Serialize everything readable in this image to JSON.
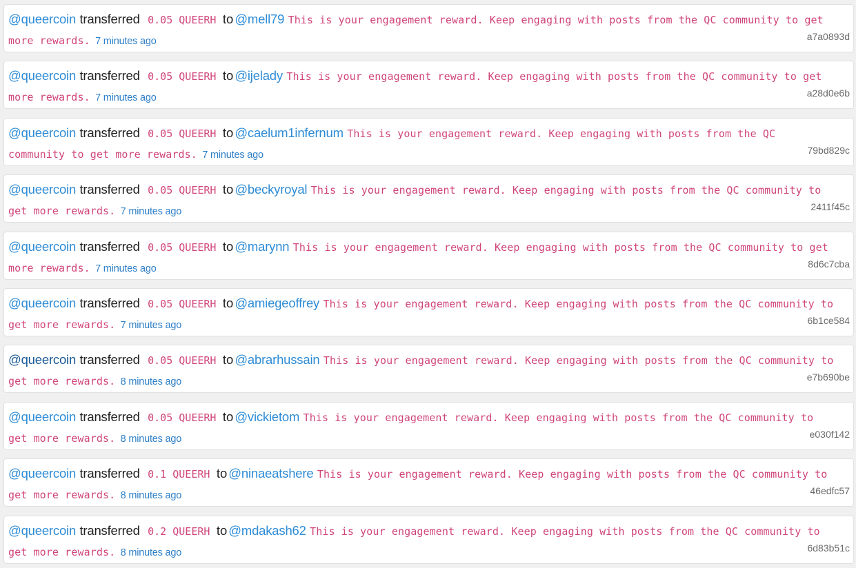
{
  "colors": {
    "page_background": "#f0f0f0",
    "card_background": "#ffffff",
    "link": "#2e8cd6",
    "link_hover": "#1a5a96",
    "memo_and_amount": "#d0457a",
    "timestamp": "#2e7fc7",
    "hash": "#6b6b6b"
  },
  "transfers": [
    {
      "from": "@queercoin",
      "verb": "transferred",
      "amount": "0.05 QUEERH",
      "to_word": "to",
      "to": "@mell79",
      "memo": "This is your engagement reward. Keep engaging with posts from the QC community to get more rewards.",
      "time": "7 minutes ago",
      "hash": "a7a0893d",
      "from_hover": false
    },
    {
      "from": "@queercoin",
      "verb": "transferred",
      "amount": "0.05 QUEERH",
      "to_word": "to",
      "to": "@ijelady",
      "memo": "This is your engagement reward. Keep engaging with posts from the QC community to get more rewards.",
      "time": "7 minutes ago",
      "hash": "a28d0e6b",
      "from_hover": false
    },
    {
      "from": "@queercoin",
      "verb": "transferred",
      "amount": "0.05 QUEERH",
      "to_word": "to",
      "to": "@caelum1infernum",
      "memo": "This is your engagement reward. Keep engaging with posts from the QC community to get more rewards.",
      "time": "7 minutes ago",
      "hash": "79bd829c",
      "from_hover": false
    },
    {
      "from": "@queercoin",
      "verb": "transferred",
      "amount": "0.05 QUEERH",
      "to_word": "to",
      "to": "@beckyroyal",
      "memo": "This is your engagement reward. Keep engaging with posts from the QC community to get more rewards.",
      "time": "7 minutes ago",
      "hash": "2411f45c",
      "from_hover": false
    },
    {
      "from": "@queercoin",
      "verb": "transferred",
      "amount": "0.05 QUEERH",
      "to_word": "to",
      "to": "@marynn",
      "memo": "This is your engagement reward. Keep engaging with posts from the QC community to get more rewards.",
      "time": "7 minutes ago",
      "hash": "8d6c7cba",
      "from_hover": false
    },
    {
      "from": "@queercoin",
      "verb": "transferred",
      "amount": "0.05 QUEERH",
      "to_word": "to",
      "to": "@amiegeoffrey",
      "memo": "This is your engagement reward. Keep engaging with posts from the QC community to get more rewards.",
      "time": "7 minutes ago",
      "hash": "6b1ce584",
      "from_hover": false
    },
    {
      "from": "@queercoin",
      "verb": "transferred",
      "amount": "0.05 QUEERH",
      "to_word": "to",
      "to": "@abrarhussain",
      "memo": "This is your engagement reward. Keep engaging with posts from the QC community to get more rewards.",
      "time": "8 minutes ago",
      "hash": "e7b690be",
      "from_hover": true
    },
    {
      "from": "@queercoin",
      "verb": "transferred",
      "amount": "0.05 QUEERH",
      "to_word": "to",
      "to": "@vickietom",
      "memo": "This is your engagement reward. Keep engaging with posts from the QC community to get more rewards.",
      "time": "8 minutes ago",
      "hash": "e030f142",
      "from_hover": false
    },
    {
      "from": "@queercoin",
      "verb": "transferred",
      "amount": "0.1 QUEERH",
      "to_word": "to",
      "to": "@ninaeatshere",
      "memo": "This is your engagement reward. Keep engaging with posts from the QC community to get more rewards.",
      "time": "8 minutes ago",
      "hash": "46edfc57",
      "from_hover": false
    },
    {
      "from": "@queercoin",
      "verb": "transferred",
      "amount": "0.2 QUEERH",
      "to_word": "to",
      "to": "@mdakash62",
      "memo": "This is your engagement reward. Keep engaging with posts from the QC community to get more rewards.",
      "time": "8 minutes ago",
      "hash": "6d83b51c",
      "from_hover": false
    }
  ]
}
